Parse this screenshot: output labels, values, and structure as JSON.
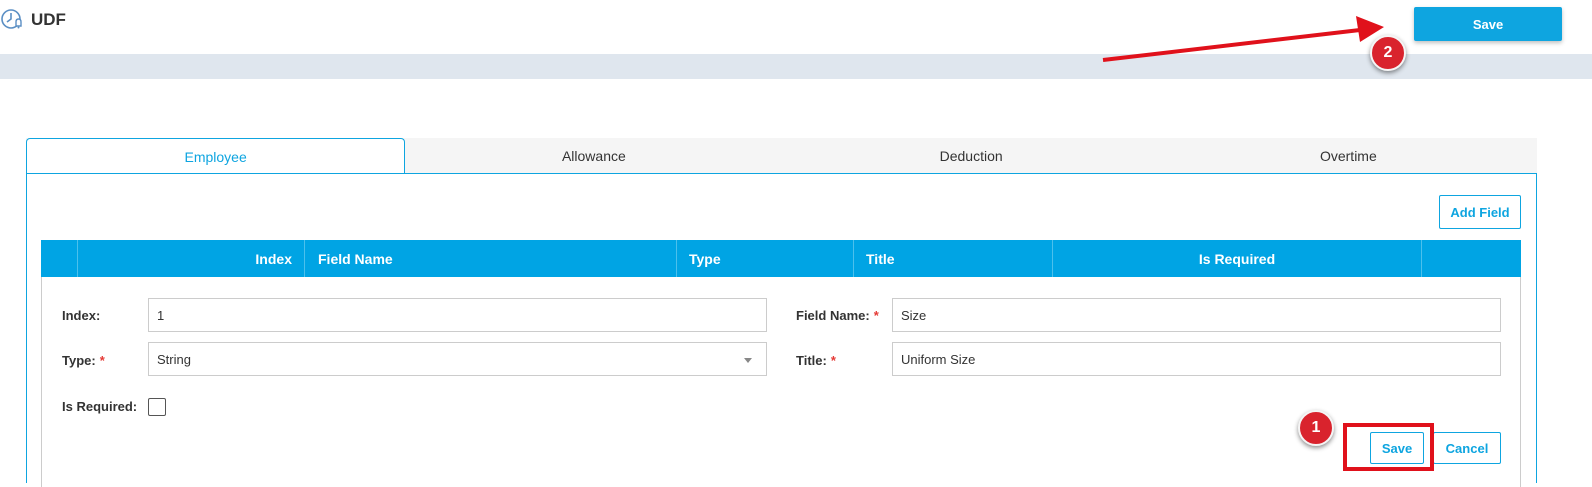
{
  "app": {
    "title": "UDF",
    "icon": "clock-bell-icon"
  },
  "toolbar": {
    "save_label": "Save"
  },
  "tabs": [
    {
      "label": "Employee",
      "active": true
    },
    {
      "label": "Allowance",
      "active": false
    },
    {
      "label": "Deduction",
      "active": false
    },
    {
      "label": "Overtime",
      "active": false
    }
  ],
  "grid": {
    "add_field_label": "Add Field",
    "columns": [
      "",
      "Index",
      "Field Name",
      "Type",
      "Title",
      "Is Required",
      ""
    ]
  },
  "form": {
    "index_label": "Index:",
    "index_value": "1",
    "field_name_label": "Field Name:",
    "field_name_value": "Size",
    "type_label": "Type:",
    "type_value": "String",
    "title_label": "Title:",
    "title_value": "Uniform Size",
    "is_required_label": "Is Required:",
    "is_required_checked": false,
    "required_marker": "*",
    "save_label": "Save",
    "cancel_label": "Cancel"
  },
  "annotations": {
    "badge_1": "1",
    "badge_2": "2"
  },
  "colors": {
    "accent": "#0ea5e0",
    "grid_header": "#00a4e4",
    "highlight": "#e0111b",
    "band": "#dfe6ee"
  }
}
